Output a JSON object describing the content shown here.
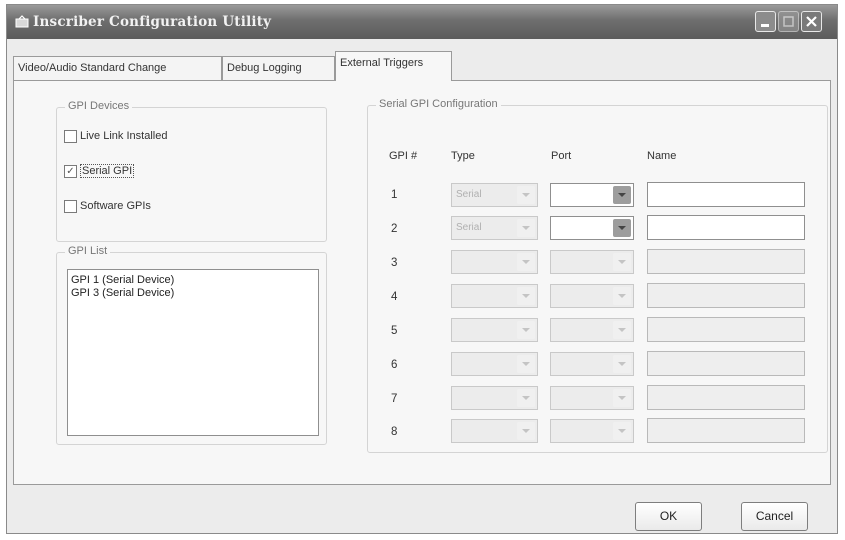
{
  "window": {
    "title": "Inscriber Configuration Utility"
  },
  "tabs": [
    {
      "label": "Video/Audio Standard Change"
    },
    {
      "label": "Debug Logging"
    },
    {
      "label": "External Triggers"
    }
  ],
  "gpi_devices": {
    "legend": "GPI Devices",
    "options": [
      {
        "label": "Live Link Installed",
        "checked": false
      },
      {
        "label": "Serial GPI",
        "checked": true
      },
      {
        "label": "Software GPIs",
        "checked": false
      }
    ]
  },
  "gpi_list": {
    "legend": "GPI List",
    "items": [
      "GPI 1 (Serial Device)",
      "GPI 3 (Serial Device)"
    ]
  },
  "serial_config": {
    "legend": "Serial GPI Configuration",
    "headers": {
      "gpi": "GPI #",
      "type": "Type",
      "port": "Port",
      "name": "Name"
    },
    "rows": [
      {
        "num": "1",
        "type": "Serial",
        "port": "",
        "name": "",
        "enabled": true
      },
      {
        "num": "2",
        "type": "Serial",
        "port": "",
        "name": "",
        "enabled": true
      },
      {
        "num": "3",
        "type": "",
        "port": "",
        "name": "",
        "enabled": false
      },
      {
        "num": "4",
        "type": "",
        "port": "",
        "name": "",
        "enabled": false
      },
      {
        "num": "5",
        "type": "",
        "port": "",
        "name": "",
        "enabled": false
      },
      {
        "num": "6",
        "type": "",
        "port": "",
        "name": "",
        "enabled": false
      },
      {
        "num": "7",
        "type": "",
        "port": "",
        "name": "",
        "enabled": false
      },
      {
        "num": "8",
        "type": "",
        "port": "",
        "name": "",
        "enabled": false
      }
    ]
  },
  "buttons": {
    "ok": "OK",
    "cancel": "Cancel"
  }
}
